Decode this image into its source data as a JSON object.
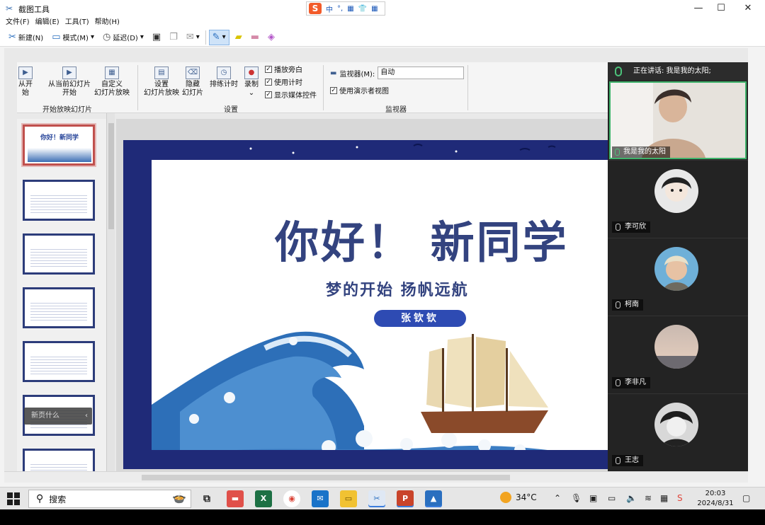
{
  "window": {
    "title": "截图工具",
    "menu": [
      "文件(F)",
      "编辑(E)",
      "工具(T)",
      "帮助(H)"
    ],
    "toolbar": {
      "new_label": "新建(N)",
      "mode_label": "模式(M)",
      "delay_label": "延迟(D)"
    },
    "controls": {
      "minimize": "—",
      "maximize": "☐",
      "close": "✕"
    }
  },
  "ime": {
    "logo": "S",
    "items": [
      "中",
      "°,",
      "▦",
      "👕",
      "▦"
    ]
  },
  "ribbon": {
    "btn_from_start": "从开始",
    "btn_from_current_l1": "从当前幻灯片",
    "btn_from_current_l2": "开始",
    "btn_custom_l1": "自定义",
    "btn_custom_l2": "幻灯片放映",
    "group_start": "开始放映幻灯片",
    "btn_setup_l1": "设置",
    "btn_setup_l2": "幻灯片放映",
    "btn_hide_l1": "隐藏",
    "btn_hide_l2": "幻灯片",
    "btn_rehearse": "排练计时",
    "btn_record": "录制",
    "chk_narration": "播放旁白",
    "chk_timing": "使用计时",
    "chk_media": "显示媒体控件",
    "group_setup": "设置",
    "monitor_label": "监视器(M):",
    "monitor_value": "自动",
    "chk_presenter": "使用演示者视图",
    "group_monitor": "监视器"
  },
  "thumbs": {
    "first_title": "你好！新同学",
    "popup": "新页什么"
  },
  "slide": {
    "title": "你好！ 新同学",
    "subtitle": "梦的开始 扬帆远航",
    "name": "张钦钦"
  },
  "meeting": {
    "speaking": "正在讲话:  我是我的太阳;",
    "video_name": "我是我的太阳",
    "participants": [
      {
        "name": "李可欣"
      },
      {
        "name": "柯南"
      },
      {
        "name": "李非凡"
      },
      {
        "name": "王志"
      }
    ]
  },
  "taskbar": {
    "search_placeholder": "搜索",
    "weather": "34°C",
    "time": "20:03",
    "date": "2024/8/31"
  }
}
